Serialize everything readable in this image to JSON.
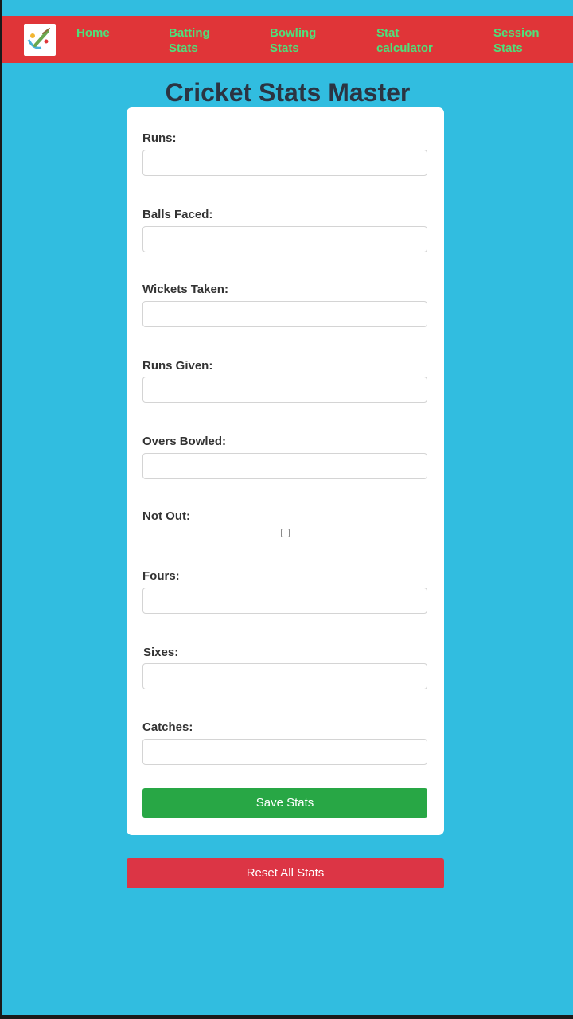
{
  "nav": {
    "logo_icon": "cricket-logo-icon",
    "items": [
      {
        "label": "Home"
      },
      {
        "label": "Batting Stats"
      },
      {
        "label": "Bowling Stats"
      },
      {
        "label": "Stat calculator"
      },
      {
        "label": "Session Stats"
      }
    ]
  },
  "title": "Cricket Stats Master",
  "form": {
    "runs_label": "Runs:",
    "runs_value": "",
    "balls_faced_label": "Balls Faced:",
    "balls_faced_value": "",
    "wickets_taken_label": "Wickets Taken:",
    "wickets_taken_value": "",
    "runs_given_label": "Runs Given:",
    "runs_given_value": "",
    "overs_bowled_label": "Overs Bowled:",
    "overs_bowled_value": "",
    "not_out_label": "Not Out:",
    "not_out_checked": false,
    "fours_label": "Fours:",
    "fours_value": "",
    "sixes_label": "Sixes:",
    "sixes_value": "",
    "catches_label": "Catches:",
    "catches_value": "",
    "save_label": "Save Stats"
  },
  "reset_label": "Reset All Stats",
  "colors": {
    "background": "#31bde0",
    "navbar": "#e03538",
    "nav_text": "#4ee07a",
    "save_button": "#28a745",
    "reset_button": "#dc3545"
  }
}
